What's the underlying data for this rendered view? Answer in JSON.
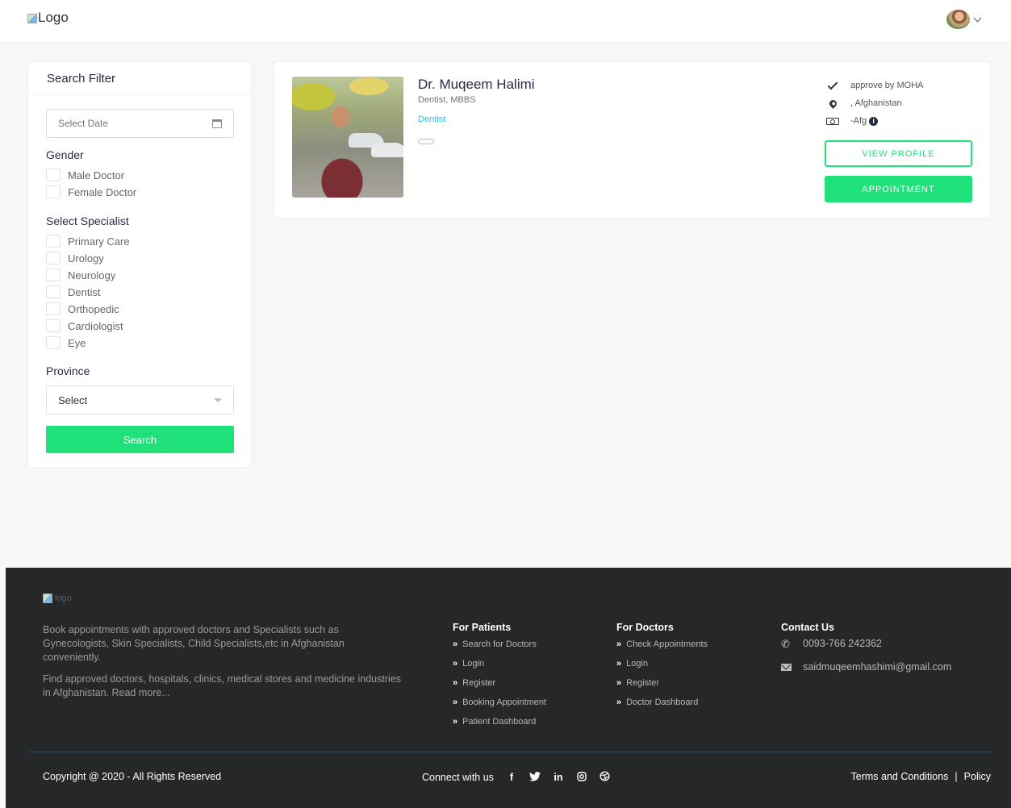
{
  "header": {
    "logo_alt": "Logo"
  },
  "filter": {
    "title": "Search Filter",
    "date_placeholder": "Select Date",
    "gender_label": "Gender",
    "gender_options": [
      "Male Doctor",
      "Female Doctor"
    ],
    "specialist_label": "Select Specialist",
    "specialist_options": [
      "Primary Care",
      "Urology",
      "Neurology",
      "Dentist",
      "Orthopedic",
      "Cardiologist",
      "Eye"
    ],
    "province_label": "Province",
    "province_value": "Select",
    "search_label": "Search"
  },
  "doctor": {
    "name": "Dr. Muqeem Halimi",
    "degree": "Dentist, MBBS",
    "specialty": "Dentist",
    "approval": "approve by MOHA",
    "location": ", Afghanistan",
    "fee": "-Afg",
    "fee_info": "i",
    "view_profile_label": "VIEW PROFILE",
    "appointment_label": "APPOINTMENT"
  },
  "footer": {
    "logo_alt": "logo",
    "about_1": "Book appointments with approved doctors and Specialists such as Gynecologists, Skin Specialists, Child Specialists,etc in Afghanistan conveniently.",
    "about_2": "Find approved doctors, hospitals, clinics, medical stores and medicine industries in Afghanistan. Read more...",
    "patients_head": "For Patients",
    "patients_links": [
      "Search for Doctors",
      "Login",
      "Register",
      "Booking Appointment",
      "Patient Dashboard"
    ],
    "doctors_head": "For Doctors",
    "doctors_links": [
      "Check Appointments",
      "Login",
      "Register",
      "Doctor Dashboard"
    ],
    "contact_head": "Contact Us",
    "phone": "0093-766 242362",
    "email": "saidmuqeemhashimi@gmail.com",
    "copyright": "Copyright @ 2020 - All Rights Reserved",
    "connect_label": "Connect with us",
    "social": [
      "f",
      "t",
      "in",
      "ig",
      "dr"
    ],
    "terms": "Terms and Conditions",
    "separator": "|",
    "policy": "Policy"
  },
  "colors": {
    "accent": "#20e07a",
    "link": "#20c0f3",
    "footer_bg": "#252729"
  }
}
